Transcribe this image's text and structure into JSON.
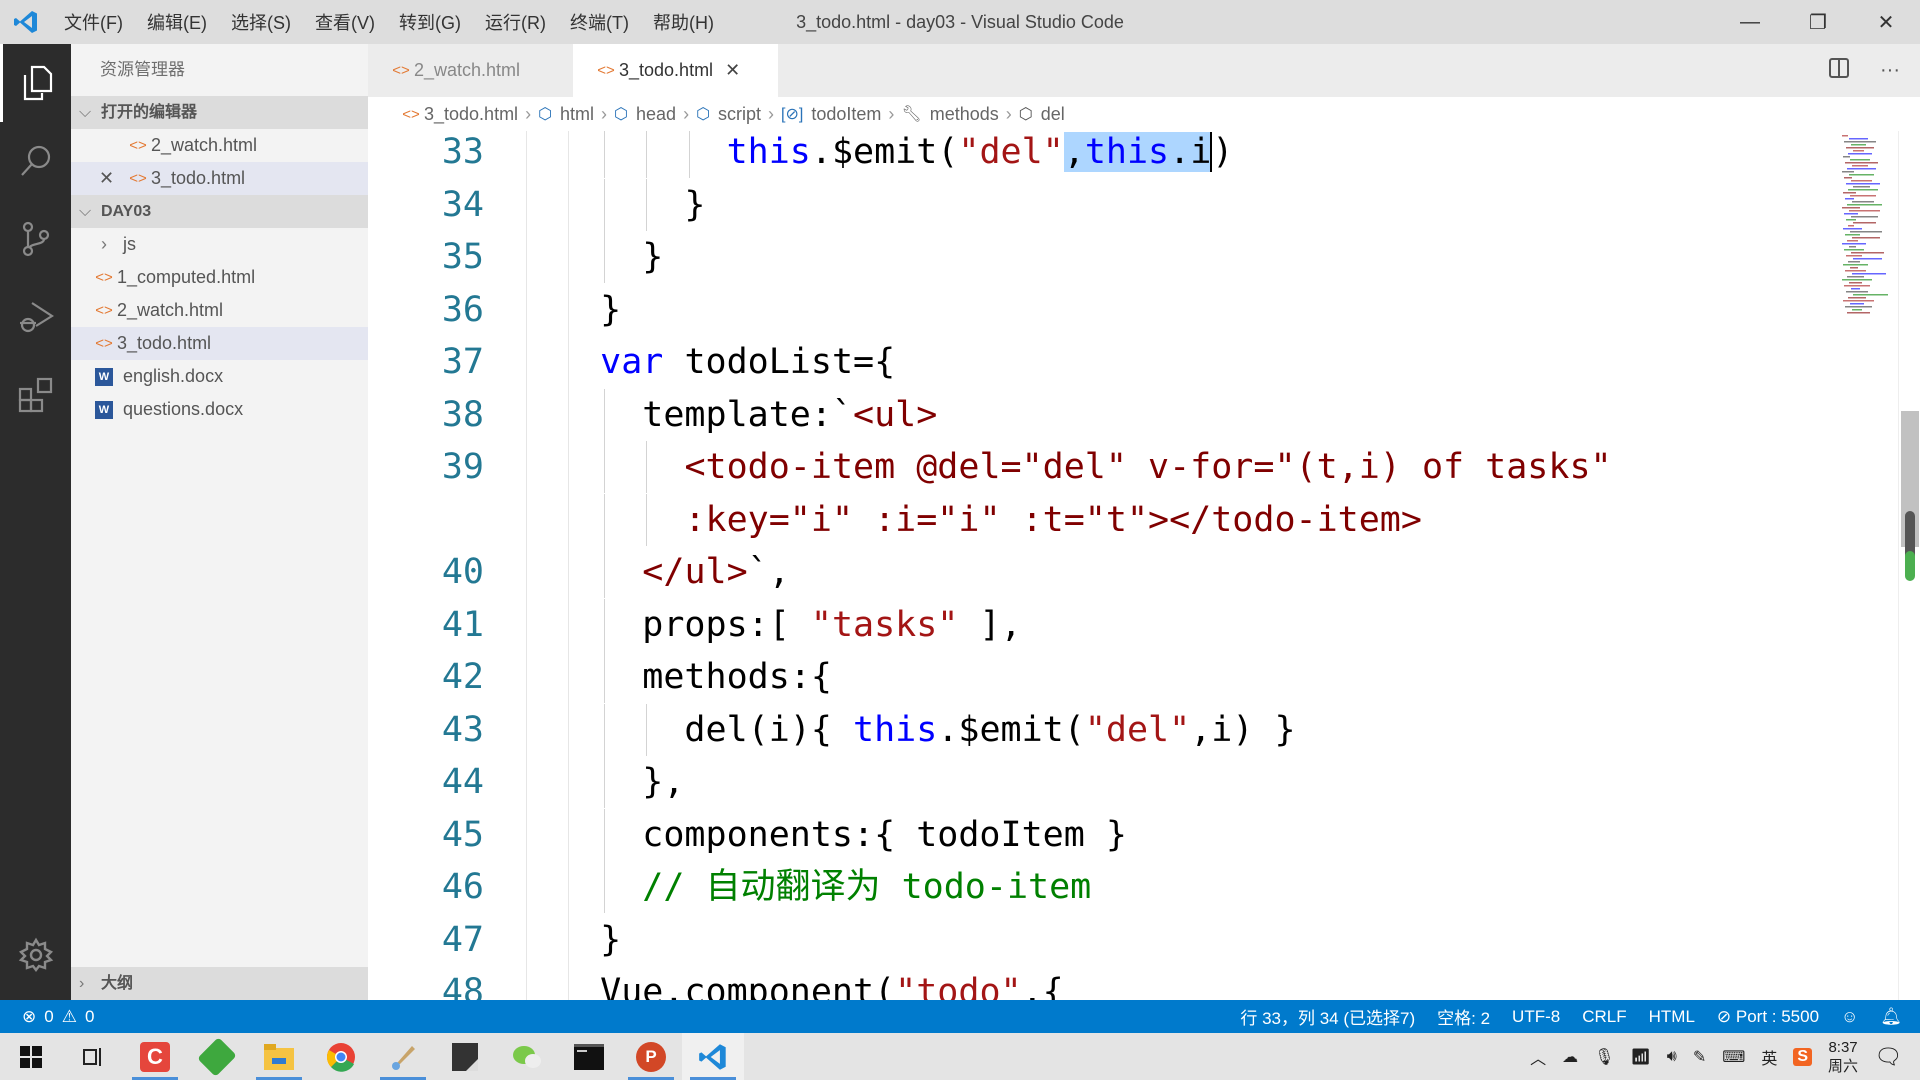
{
  "titlebar": {
    "app_icon": "vscode-logo-icon",
    "menu": [
      "文件(F)",
      "编辑(E)",
      "选择(S)",
      "查看(V)",
      "转到(G)",
      "运行(R)",
      "终端(T)",
      "帮助(H)"
    ],
    "window_title": "3_todo.html - day03 - Visual Studio Code",
    "controls": {
      "minimize": "—",
      "restore": "❐",
      "close": "✕"
    }
  },
  "activity_bar": [
    {
      "name": "explorer",
      "icon": "files-icon",
      "active": true
    },
    {
      "name": "search",
      "icon": "search-icon"
    },
    {
      "name": "source-control",
      "icon": "source-control-icon"
    },
    {
      "name": "run-debug",
      "icon": "run-debug-icon"
    },
    {
      "name": "extensions",
      "icon": "extensions-icon"
    },
    {
      "name": "manage",
      "icon": "gear-icon"
    }
  ],
  "sidebar": {
    "title": "资源管理器",
    "open_editors": {
      "header": "打开的编辑器",
      "items": [
        {
          "label": "2_watch.html",
          "icon": "html-file-icon"
        },
        {
          "label": "3_todo.html",
          "icon": "html-file-icon",
          "close": "✕",
          "selected": true
        }
      ]
    },
    "folder": {
      "header": "DAY03",
      "items": [
        {
          "label": "js",
          "type": "folder"
        },
        {
          "label": "1_computed.html",
          "type": "html"
        },
        {
          "label": "2_watch.html",
          "type": "html"
        },
        {
          "label": "3_todo.html",
          "type": "html",
          "selected": true
        },
        {
          "label": "english.docx",
          "type": "word"
        },
        {
          "label": "questions.docx",
          "type": "word"
        }
      ]
    },
    "outline_header": "大纲"
  },
  "tabs": [
    {
      "label": "2_watch.html",
      "active": false
    },
    {
      "label": "3_todo.html",
      "active": true,
      "close": "✕"
    }
  ],
  "breadcrumb": [
    {
      "label": "3_todo.html",
      "icon": "html-file-icon"
    },
    {
      "label": "html",
      "icon": "element-icon"
    },
    {
      "label": "head",
      "icon": "element-icon"
    },
    {
      "label": "script",
      "icon": "element-icon"
    },
    {
      "label": "todoItem",
      "icon": "variable-icon"
    },
    {
      "label": "methods",
      "icon": "property-wrench-icon"
    },
    {
      "label": "del",
      "icon": "method-cube-icon"
    }
  ],
  "editor": {
    "lines": [
      {
        "num": "33",
        "text": "        this.$emit(\"del\",this.i)"
      },
      {
        "num": "34",
        "text": "      }"
      },
      {
        "num": "35",
        "text": "    }"
      },
      {
        "num": "36",
        "text": "  }"
      },
      {
        "num": "37",
        "text": "  var todoList={"
      },
      {
        "num": "38",
        "text": "    template:`<ul>"
      },
      {
        "num": "39",
        "text": "      <todo-item @del=\"del\" v-for=\"(t,i) of tasks\""
      },
      {
        "num": "",
        "text": "      :key=\"i\" :i=\"i\" :t=\"t\"></todo-item>"
      },
      {
        "num": "40",
        "text": "    </ul>`,"
      },
      {
        "num": "41",
        "text": "    props:[ \"tasks\" ],"
      },
      {
        "num": "42",
        "text": "    methods:{"
      },
      {
        "num": "43",
        "text": "      del(i){ this.$emit(\"del\",i) }"
      },
      {
        "num": "44",
        "text": "    },"
      },
      {
        "num": "45",
        "text": "    components:{ todoItem }"
      },
      {
        "num": "46",
        "text": "    // 自动翻译为 todo-item"
      },
      {
        "num": "47",
        "text": "  }"
      },
      {
        "num": "48",
        "text": "  Vue.component(\"todo\",{"
      }
    ],
    "selection_text": ",this.i"
  },
  "statusbar": {
    "errors": "0",
    "warnings": "0",
    "cursor": "行 33，列 34 (已选择7)",
    "indent": "空格: 2",
    "encoding": "UTF-8",
    "eol": "CRLF",
    "language": "HTML",
    "live_server": "Port : 5500"
  },
  "taskbar": {
    "apps": [
      {
        "name": "start",
        "icon": "windows-start-icon"
      },
      {
        "name": "task-view",
        "icon": "task-view-icon"
      },
      {
        "name": "camtasia",
        "icon": "camtasia-icon",
        "running": true
      },
      {
        "name": "app-green",
        "icon": "green-app-icon"
      },
      {
        "name": "file-explorer",
        "icon": "folder-icon",
        "running": true
      },
      {
        "name": "chrome",
        "icon": "chrome-icon"
      },
      {
        "name": "paint-tool",
        "icon": "paint-icon",
        "running": true
      },
      {
        "name": "notes-app",
        "icon": "notes-icon"
      },
      {
        "name": "wechat",
        "icon": "wechat-icon"
      },
      {
        "name": "terminal",
        "icon": "terminal-icon"
      },
      {
        "name": "powerpoint",
        "icon": "powerpoint-icon",
        "running": true
      },
      {
        "name": "vscode",
        "icon": "vscode-icon",
        "running": true,
        "focused": true
      }
    ],
    "tray": {
      "ime": "英",
      "time": "8:37",
      "day": "周六"
    }
  }
}
